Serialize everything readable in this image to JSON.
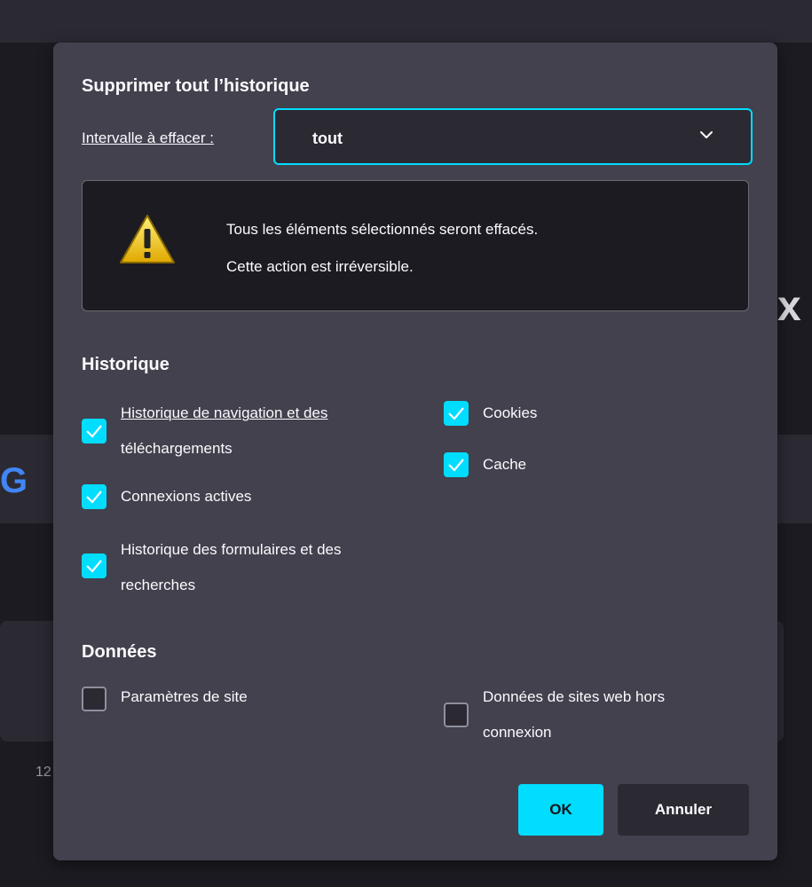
{
  "background": {
    "corner_text": "12"
  },
  "dialog": {
    "title": "Supprimer tout l’historique",
    "range": {
      "label": "Intervalle à effacer :",
      "value": "tout",
      "icon": "chevron-down-icon"
    },
    "warning": {
      "icon": "warning-icon",
      "line1": "Tous les éléments sélectionnés seront effacés.",
      "line2": "Cette action est irréversible."
    },
    "history_section": {
      "title": "Historique",
      "options": [
        {
          "line1": "Historique de navigation et des",
          "line2": "téléchargements",
          "checked": true
        },
        {
          "label": "Connexions actives",
          "checked": true
        },
        {
          "line1": "Historique des formulaires et des",
          "line2": "recherches",
          "checked": true
        },
        {
          "label": "Cookies",
          "checked": true
        },
        {
          "label": "Cache",
          "checked": true
        }
      ]
    },
    "data_section": {
      "title": "Données",
      "options": [
        {
          "label": "Paramètres de site",
          "checked": false
        },
        {
          "line1": "Données de sites web hors",
          "line2": "connexion",
          "checked": false
        }
      ]
    },
    "buttons": {
      "ok": "OK",
      "cancel": "Annuler"
    },
    "colors": {
      "accent": "#00ddff",
      "dialog_bg": "#42414d",
      "page_bg": "#1c1b22"
    }
  }
}
